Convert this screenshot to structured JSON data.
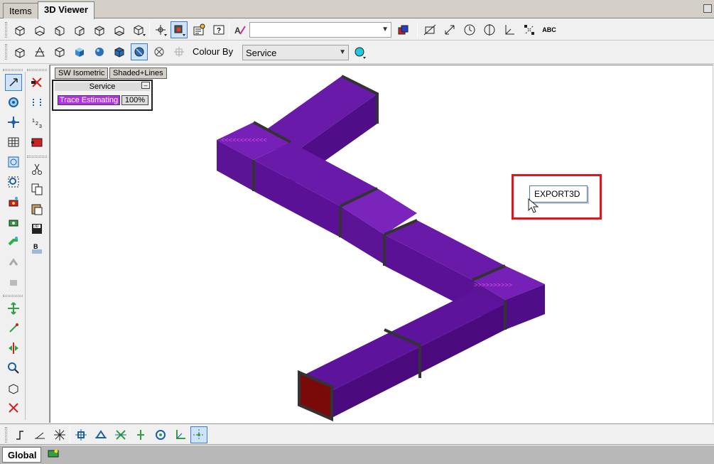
{
  "tabs": [
    {
      "label": "Items",
      "active": false
    },
    {
      "label": "3D Viewer",
      "active": true
    }
  ],
  "toolbar1": {
    "view_icons": [
      "view-front-icon",
      "view-back-icon",
      "view-left-icon",
      "view-right-icon",
      "view-top-icon",
      "view-bottom-icon",
      "view-iso-dropdown-icon"
    ],
    "view_select_value": "",
    "text_label_button": "ABC"
  },
  "toolbar2": {
    "colour_by_label": "Colour By",
    "colour_by_value": "Service"
  },
  "viewport": {
    "view_button": "SW Isometric",
    "shade_button": "Shaded+Lines",
    "legend": {
      "title": "Service",
      "minimize": "–",
      "entries": [
        {
          "name": "Trace Estimating",
          "value": "100%",
          "color": "#b430e8"
        }
      ]
    },
    "command_input": "EXPORT3D",
    "duct_color": "#5b0e8e",
    "highlight_color": "#e0161d"
  },
  "status": {
    "layout_tab": "Global"
  }
}
